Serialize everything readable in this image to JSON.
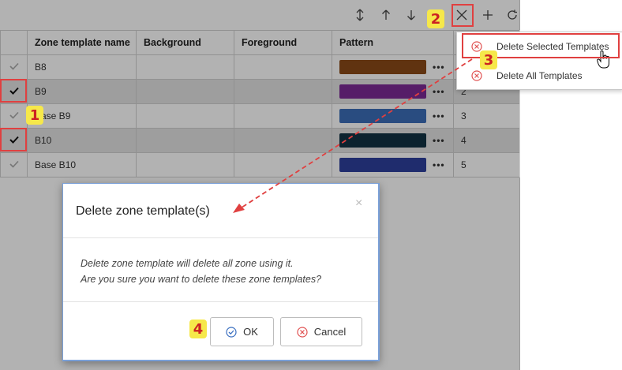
{
  "toolbar": {
    "icons": [
      "sort-icon",
      "move-up-icon",
      "move-down-icon",
      "delete-icon",
      "add-icon",
      "refresh-icon"
    ]
  },
  "table": {
    "columns": [
      "Zone template name",
      "Background",
      "Foreground",
      "Pattern"
    ],
    "rows": [
      {
        "name": "B8",
        "color": "#8a4a17",
        "num": "",
        "checked": false
      },
      {
        "name": "B9",
        "color": "#7b2a96",
        "num": "2",
        "checked": true
      },
      {
        "name": "Base B9",
        "color": "#3c6db8",
        "num": "3",
        "checked": false
      },
      {
        "name": "B10",
        "color": "#123344",
        "num": "4",
        "checked": true
      },
      {
        "name": "Base B10",
        "color": "#2d3f9c",
        "num": "5",
        "checked": false
      }
    ],
    "more_glyph": "•••"
  },
  "menu": {
    "items": [
      {
        "label": "Delete Selected Templates"
      },
      {
        "label": "Delete All Templates"
      }
    ]
  },
  "dialog": {
    "title": "Delete zone template(s)",
    "close_glyph": "×",
    "line1": "Delete zone template will delete all zone using it.",
    "line2": "Are you sure you want to delete these zone templates?",
    "ok_label": "OK",
    "cancel_label": "Cancel"
  },
  "annotations": {
    "step1": "1",
    "step2": "2",
    "step3": "3",
    "step4": "4"
  },
  "colors": {
    "highlight": "#e04040",
    "badge": "#f6e84a",
    "dialog_border": "#7aa0d8"
  }
}
